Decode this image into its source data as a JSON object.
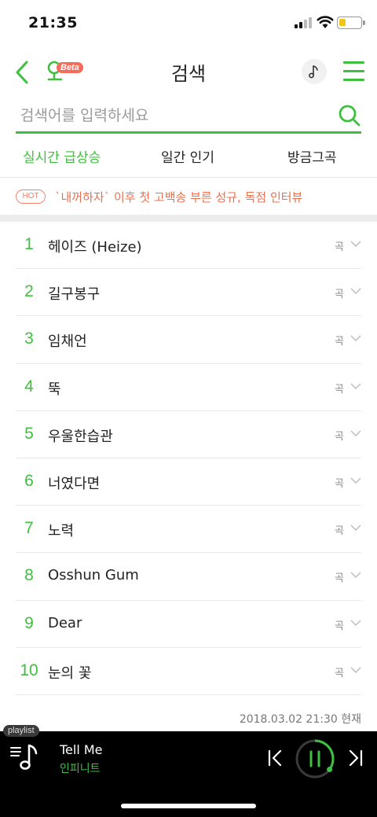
{
  "status_bar": {
    "time": "21:35"
  },
  "header": {
    "title": "검색",
    "beta_label": "Beta"
  },
  "search": {
    "placeholder": "검색어를 입력하세요"
  },
  "tabs": [
    {
      "label": "실시간 급상승",
      "active": true
    },
    {
      "label": "일간 인기",
      "active": false
    },
    {
      "label": "방금그곡",
      "active": false
    }
  ],
  "hot_banner": {
    "badge": "HOT",
    "text": "`내꺼하자` 이후 첫 고백송 부른 성규, 독점 인터뷰"
  },
  "chart": [
    {
      "rank": "1",
      "keyword": "헤이즈 (Heize)",
      "type": "곡"
    },
    {
      "rank": "2",
      "keyword": "길구봉구",
      "type": "곡"
    },
    {
      "rank": "3",
      "keyword": "임채언",
      "type": "곡"
    },
    {
      "rank": "4",
      "keyword": "뚝",
      "type": "곡"
    },
    {
      "rank": "5",
      "keyword": "우울한습관",
      "type": "곡"
    },
    {
      "rank": "6",
      "keyword": "너였다면",
      "type": "곡"
    },
    {
      "rank": "7",
      "keyword": "노력",
      "type": "곡"
    },
    {
      "rank": "8",
      "keyword": "Osshun Gum",
      "type": "곡"
    },
    {
      "rank": "9",
      "keyword": "Dear",
      "type": "곡"
    },
    {
      "rank": "10",
      "keyword": "눈의 꽃",
      "type": "곡"
    }
  ],
  "timestamp": "2018.03.02 21:30 현재",
  "player": {
    "playlist_label": "playlist",
    "song": "Tell Me",
    "artist": "인피니트",
    "progress": 0.35
  },
  "colors": {
    "accent": "#3fbf3f",
    "hot": "#e9704f"
  }
}
